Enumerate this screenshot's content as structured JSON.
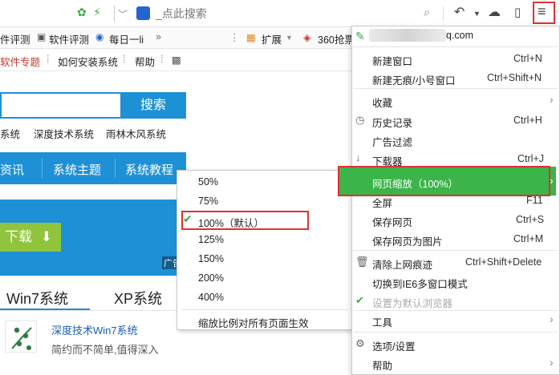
{
  "addressbar": {
    "search_placeholder": "_点此搜索",
    "paw_glyph": "🐾"
  },
  "bookmarks": {
    "item1": "件评测",
    "item2": "软件评测",
    "item3": "每日一li",
    "more": "»",
    "extensions": "扩展",
    "item4": "360抢票"
  },
  "site_nav": {
    "topic": "软件专题",
    "install": "如何安装系统",
    "help": "帮助"
  },
  "search": {
    "button": "搜索",
    "tags": [
      "系统",
      "深度技术系统",
      "雨林木风系统"
    ]
  },
  "blue_nav": [
    "资讯",
    "系统主题",
    "系统教程"
  ],
  "banner": {
    "download": "下载",
    "ad": "广告"
  },
  "tabs": [
    "Win7系统",
    "XP系统"
  ],
  "item": {
    "title": "深度技术Win7系统",
    "subtitle": "简约而不简单,值得深入"
  },
  "zoom_menu": {
    "options": [
      "50%",
      "75%",
      "100%（默认）",
      "125%",
      "150%",
      "200%",
      "400%"
    ],
    "selected": "100%（默认）",
    "apply_all": "缩放比例对所有页面生效"
  },
  "main_menu": {
    "account_suffix": "q.com",
    "items": [
      {
        "label": "新建窗口",
        "shortcut": "Ctrl+N"
      },
      {
        "label": "新建无痕/小号窗口",
        "shortcut": "Ctrl+Shift+N"
      },
      {
        "label": "收藏",
        "shortcut": ""
      },
      {
        "label": "历史记录",
        "shortcut": "Ctrl+H"
      },
      {
        "label": "广告过滤",
        "shortcut": ""
      },
      {
        "label": "下载器",
        "shortcut": "Ctrl+J"
      },
      {
        "label": "网页缩放（100%）",
        "shortcut": ""
      },
      {
        "label": "全屏",
        "shortcut": "F11"
      },
      {
        "label": "保存网页",
        "shortcut": "Ctrl+S"
      },
      {
        "label": "保存网页为图片",
        "shortcut": "Ctrl+M"
      },
      {
        "label": "清除上网痕迹",
        "shortcut": "Ctrl+Shift+Delete"
      },
      {
        "label": "切换到IE6多窗口模式",
        "shortcut": ""
      },
      {
        "label": "设置为默认浏览器",
        "shortcut": ""
      },
      {
        "label": "工具",
        "shortcut": ""
      },
      {
        "label": "选项/设置",
        "shortcut": ""
      },
      {
        "label": "帮助",
        "shortcut": ""
      }
    ]
  },
  "colors": {
    "accent_blue": "#1e90d6",
    "highlight_green": "#3bb449",
    "annotation_red": "#e03030"
  }
}
